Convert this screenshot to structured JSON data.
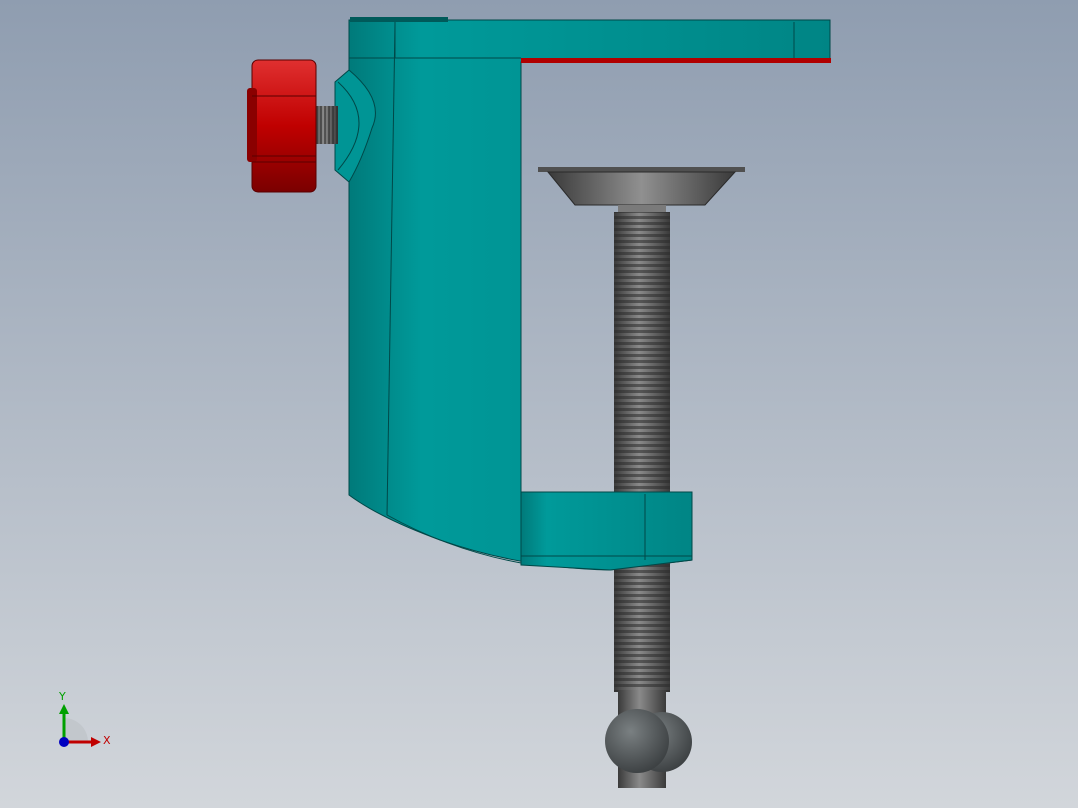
{
  "viewport": {
    "background_top": "#8f9db0",
    "background_bottom": "#d2d6db"
  },
  "model": {
    "frame_color": "#008b8b",
    "frame_shade": "#006e6e",
    "knob_color": "#c00000",
    "knob_shade": "#800000",
    "screw_color": "#4a4a4a",
    "screw_light": "#7a7a7a",
    "ball_color": "#4f5456",
    "accent_strip": "#b00000"
  },
  "triad": {
    "x_label": "X",
    "y_label": "Y",
    "x_color": "#c00000",
    "y_color": "#00a000",
    "z_color": "#0000c0"
  }
}
